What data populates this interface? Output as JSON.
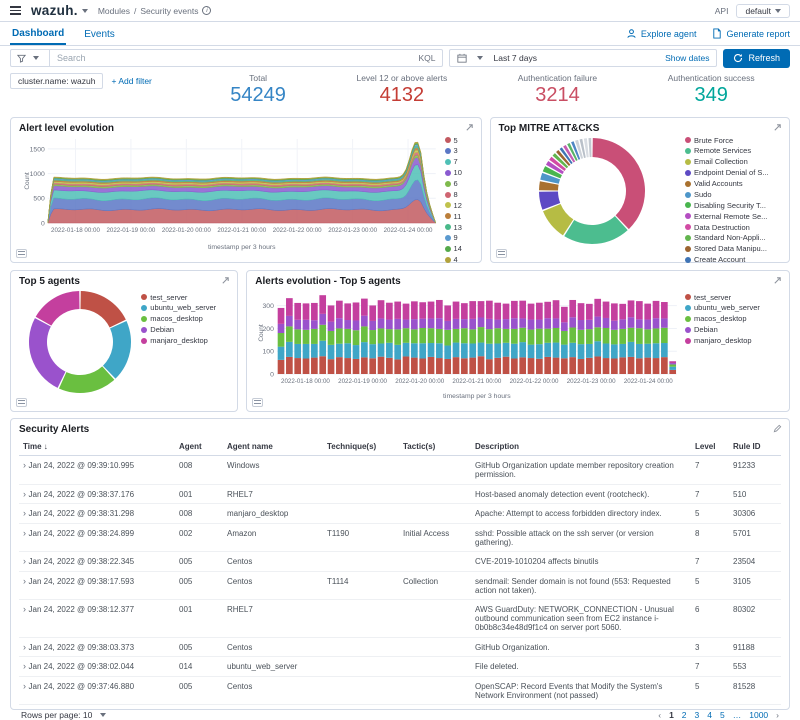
{
  "topbar": {
    "logo": "wazuh.",
    "breadcrumb_section": "Modules",
    "breadcrumb_separator": "/",
    "breadcrumb_page": "Security events",
    "api_label": "API",
    "api_value": "default"
  },
  "tabs": {
    "dashboard": "Dashboard",
    "events": "Events",
    "explore_agent": "Explore agent",
    "generate_report": "Generate report"
  },
  "search": {
    "placeholder": "Search",
    "kql": "KQL",
    "time_range": "Last 7 days",
    "show_dates": "Show dates",
    "refresh": "Refresh"
  },
  "filters": {
    "chip": "cluster.name: wazuh",
    "add": "+ Add filter"
  },
  "metrics": {
    "items": [
      {
        "label": "Total",
        "value": "54249",
        "color": "#3585c5"
      },
      {
        "label": "Level 12 or above alerts",
        "value": "4132",
        "color": "#c43d35"
      },
      {
        "label": "Authentication failure",
        "value": "3214",
        "color": "#c94e63"
      },
      {
        "label": "Authentication success",
        "value": "349",
        "color": "#00a69b"
      }
    ]
  },
  "panels": {
    "alert_level": {
      "title": "Alert level evolution"
    },
    "mitre": {
      "title": "Top MITRE ATT&CKS"
    },
    "top5": {
      "title": "Top 5 agents"
    },
    "evolution": {
      "title": "Alerts evolution - Top 5 agents"
    }
  },
  "chart_data": [
    {
      "id": "alert_level_evolution",
      "type": "area",
      "stacked": true,
      "title": "Alert level evolution",
      "xlabel": "timestamp per 3 hours",
      "ylabel": "Count",
      "x_ticks": [
        "2022-01-18 00:00",
        "2022-01-19 00:00",
        "2022-01-20 00:00",
        "2022-01-21 00:00",
        "2022-01-22 00:00",
        "2022-01-23 00:00",
        "2022-01-24 00:00"
      ],
      "y_ticks": [
        0,
        500,
        1000,
        1500
      ],
      "ylim": [
        0,
        1700
      ],
      "steady_total": 910,
      "spike_peak_total": 1640,
      "legend_position": "right",
      "series": [
        {
          "name": "5",
          "color": "#c25a60",
          "base": 270
        },
        {
          "name": "3",
          "color": "#5b77c5",
          "base": 210
        },
        {
          "name": "7",
          "color": "#4fc0b6",
          "base": 165
        },
        {
          "name": "10",
          "color": "#8a5ad0",
          "base": 85
        },
        {
          "name": "6",
          "color": "#7fba4c",
          "base": 32
        },
        {
          "name": "8",
          "color": "#cf6571",
          "base": 30
        },
        {
          "name": "12",
          "color": "#c0c24d",
          "base": 28
        },
        {
          "name": "11",
          "color": "#bb7e3a",
          "base": 24
        },
        {
          "name": "13",
          "color": "#49b98a",
          "base": 20
        },
        {
          "name": "9",
          "color": "#5a99cf",
          "base": 18
        },
        {
          "name": "14",
          "color": "#54a94a",
          "base": 15
        },
        {
          "name": "4",
          "color": "#b2a23b",
          "base": 12
        }
      ]
    },
    {
      "id": "top_mitre_attacks",
      "type": "pie",
      "title": "Top MITRE ATT&CKS",
      "legend_position": "right",
      "slices": [
        {
          "label": "Brute Force",
          "color": "#c94f77",
          "value": 38
        },
        {
          "label": "Remote Services",
          "color": "#4cbd8f",
          "value": 21
        },
        {
          "label": "Email Collection",
          "color": "#b6bc44",
          "value": 10
        },
        {
          "label": "Endpoint Denial of S...",
          "color": "#5d4ac4",
          "value": 6
        },
        {
          "label": "Valid Accounts",
          "color": "#a9712f",
          "value": 3.2
        },
        {
          "label": "Sudo",
          "color": "#4e96c9",
          "value": 2.6
        },
        {
          "label": "Disabling Security T...",
          "color": "#49b54e",
          "value": 2.2
        },
        {
          "label": "External Remote Se...",
          "color": "#b44ec2",
          "value": 1.8
        },
        {
          "label": "Data Destruction",
          "color": "#d24ba4",
          "value": 1.6
        },
        {
          "label": "Standard Non-Appli...",
          "color": "#62b54e",
          "value": 1.5
        },
        {
          "label": "Stored Data Manipu...",
          "color": "#9c6430",
          "value": 1.4
        },
        {
          "label": "Create Account",
          "color": "#3f74b5",
          "value": 1.3
        },
        {
          "label": "",
          "color": "#c45db2",
          "value": 1.4
        },
        {
          "label": "",
          "color": "#58b368",
          "value": 1.3
        },
        {
          "label": "",
          "color": "#4f86c4",
          "value": 1.3
        },
        {
          "label": "",
          "color": "#cdd2d9",
          "value": 1.4
        },
        {
          "label": "",
          "color": "#b9c0c9",
          "value": 1.3
        },
        {
          "label": "",
          "color": "#d8dce2",
          "value": 1.4
        },
        {
          "label": "",
          "color": "#c3c9d1",
          "value": 1.3
        }
      ]
    },
    {
      "id": "top_5_agents",
      "type": "pie",
      "title": "Top 5 agents",
      "legend_position": "right",
      "slices": [
        {
          "label": "test_server",
          "color": "#bf5146",
          "value": 18
        },
        {
          "label": "ubuntu_web_server",
          "color": "#3fa6c7",
          "value": 20
        },
        {
          "label": "macos_desktop",
          "color": "#6abf40",
          "value": 19
        },
        {
          "label": "Debian",
          "color": "#9a52cc",
          "value": 26
        },
        {
          "label": "manjaro_desktop",
          "color": "#c43f9e",
          "value": 17
        }
      ]
    },
    {
      "id": "alerts_evolution_top5",
      "type": "bar",
      "stacked": true,
      "title": "Alerts evolution - Top 5 agents",
      "xlabel": "timestamp per 3 hours",
      "ylabel": "Count",
      "x_ticks": [
        "2022-01-18 00:00",
        "2022-01-19 00:00",
        "2022-01-20 00:00",
        "2022-01-21 00:00",
        "2022-01-22 00:00",
        "2022-01-23 00:00",
        "2022-01-24 00:00"
      ],
      "y_ticks": [
        0,
        100,
        200,
        300
      ],
      "ylim": [
        0,
        360
      ],
      "legend_position": "right",
      "series": [
        {
          "name": "test_server",
          "color": "#bf5146",
          "values": [
            62,
            75,
            70,
            68,
            72,
            78,
            65,
            74,
            70,
            66,
            73,
            69,
            76,
            71,
            64,
            77,
            72,
            68,
            75,
            70,
            66,
            74,
            69,
            72,
            78,
            65,
            71,
            76,
            68,
            73,
            70,
            67,
            75,
            72,
            69,
            74,
            66,
            71,
            77,
            70,
            68,
            73,
            75,
            69,
            72,
            70,
            74,
            18
          ]
        },
        {
          "name": "ubuntu_web_server",
          "color": "#3fa6c7",
          "values": [
            58,
            66,
            62,
            64,
            60,
            68,
            63,
            59,
            65,
            61,
            67,
            62,
            58,
            66,
            64,
            60,
            63,
            67,
            61,
            65,
            59,
            64,
            66,
            62,
            60,
            68,
            63,
            61,
            65,
            67,
            59,
            64,
            62,
            66,
            60,
            63,
            65,
            61,
            67,
            64,
            62,
            59,
            66,
            63,
            61,
            65,
            62,
            14
          ]
        },
        {
          "name": "macos_desktop",
          "color": "#6abf40",
          "values": [
            60,
            68,
            64,
            62,
            66,
            70,
            61,
            67,
            63,
            65,
            69,
            62,
            66,
            60,
            68,
            64,
            61,
            67,
            65,
            63,
            69,
            60,
            66,
            62,
            68,
            64,
            67,
            61,
            65,
            63,
            66,
            68,
            62,
            64,
            60,
            67,
            63,
            65,
            61,
            68,
            64,
            66,
            62,
            69,
            63,
            65,
            67,
            10
          ]
        },
        {
          "name": "Debian",
          "color": "#9a52cc",
          "values": [
            40,
            46,
            42,
            44,
            38,
            48,
            41,
            45,
            39,
            43,
            47,
            40,
            44,
            42,
            46,
            38,
            45,
            41,
            43,
            47,
            39,
            44,
            40,
            46,
            42,
            45,
            38,
            43,
            47,
            41,
            44,
            40,
            46,
            42,
            38,
            45,
            43,
            41,
            47,
            44,
            40,
            42,
            46,
            39,
            43,
            45,
            41,
            6
          ]
        },
        {
          "name": "manjaro_desktop",
          "color": "#c43f9e",
          "values": [
            70,
            78,
            74,
            72,
            76,
            82,
            71,
            77,
            73,
            79,
            75,
            68,
            80,
            74,
            76,
            70,
            78,
            72,
            74,
            80,
            68,
            76,
            70,
            78,
            72,
            80,
            74,
            68,
            76,
            78,
            70,
            74,
            72,
            80,
            68,
            76,
            74,
            70,
            78,
            72,
            76,
            68,
            74,
            80,
            70,
            76,
            72,
            8
          ]
        }
      ]
    }
  ],
  "table": {
    "title": "Security Alerts",
    "sort_indicator": "↓",
    "expand_glyph": "›",
    "columns": [
      "Time",
      "Agent",
      "Agent name",
      "Technique(s)",
      "Tactic(s)",
      "Description",
      "Level",
      "Rule ID"
    ],
    "rows": [
      {
        "time": "Jan 24, 2022 @ 09:39:10.995",
        "agent": "008",
        "agent_name": "Windows",
        "technique": "",
        "tactic": "",
        "description": "GitHub Organization update member repository creation permission.",
        "level": "7",
        "rule_id": "91233"
      },
      {
        "time": "Jan 24, 2022 @ 09:38:37.176",
        "agent": "001",
        "agent_name": "RHEL7",
        "technique": "",
        "tactic": "",
        "description": "Host-based anomaly detection event (rootcheck).",
        "level": "7",
        "rule_id": "510"
      },
      {
        "time": "Jan 24, 2022 @ 09:38:31.298",
        "agent": "008",
        "agent_name": "manjaro_desktop",
        "technique": "",
        "tactic": "",
        "description": "Apache: Attempt to access forbidden directory index.",
        "level": "5",
        "rule_id": "30306"
      },
      {
        "time": "Jan 24, 2022 @ 09:38:24.899",
        "agent": "002",
        "agent_name": "Amazon",
        "technique": "T1190",
        "tactic": "Initial Access",
        "description": "sshd: Possible attack on the ssh server (or version gathering).",
        "level": "8",
        "rule_id": "5701"
      },
      {
        "time": "Jan 24, 2022 @ 09:38:22.345",
        "agent": "005",
        "agent_name": "Centos",
        "technique": "",
        "tactic": "",
        "description": "CVE-2019-1010204 affects binutils",
        "level": "7",
        "rule_id": "23504"
      },
      {
        "time": "Jan 24, 2022 @ 09:38:17.593",
        "agent": "005",
        "agent_name": "Centos",
        "technique": "T1114",
        "tactic": "Collection",
        "description": "sendmail: Sender domain is not found (553: Requested action not taken).",
        "level": "5",
        "rule_id": "3105"
      },
      {
        "time": "Jan 24, 2022 @ 09:38:12.377",
        "agent": "001",
        "agent_name": "RHEL7",
        "technique": "",
        "tactic": "",
        "description": "AWS GuardDuty: NETWORK_CONNECTION - Unusual outbound communication seen from EC2 instance i-0b0b8c34e48d9f1c4 on server port 5060.",
        "level": "6",
        "rule_id": "80302"
      },
      {
        "time": "Jan 24, 2022 @ 09:38:03.373",
        "agent": "005",
        "agent_name": "Centos",
        "technique": "",
        "tactic": "",
        "description": "GitHub Organization.",
        "level": "3",
        "rule_id": "91188"
      },
      {
        "time": "Jan 24, 2022 @ 09:38:02.044",
        "agent": "014",
        "agent_name": "ubuntu_web_server",
        "technique": "",
        "tactic": "",
        "description": "File deleted.",
        "level": "7",
        "rule_id": "553"
      },
      {
        "time": "Jan 24, 2022 @ 09:37:46.880",
        "agent": "005",
        "agent_name": "Centos",
        "technique": "",
        "tactic": "",
        "description": "OpenSCAP: Record Events that Modify the System's Network Environment (not passed)",
        "level": "5",
        "rule_id": "81528"
      }
    ],
    "pagination": {
      "rows_per_page": "Rows per page: 10",
      "prev": "‹",
      "pages": [
        "1",
        "2",
        "3",
        "4",
        "5",
        "…",
        "1000"
      ],
      "active": "1",
      "next": "›"
    }
  }
}
